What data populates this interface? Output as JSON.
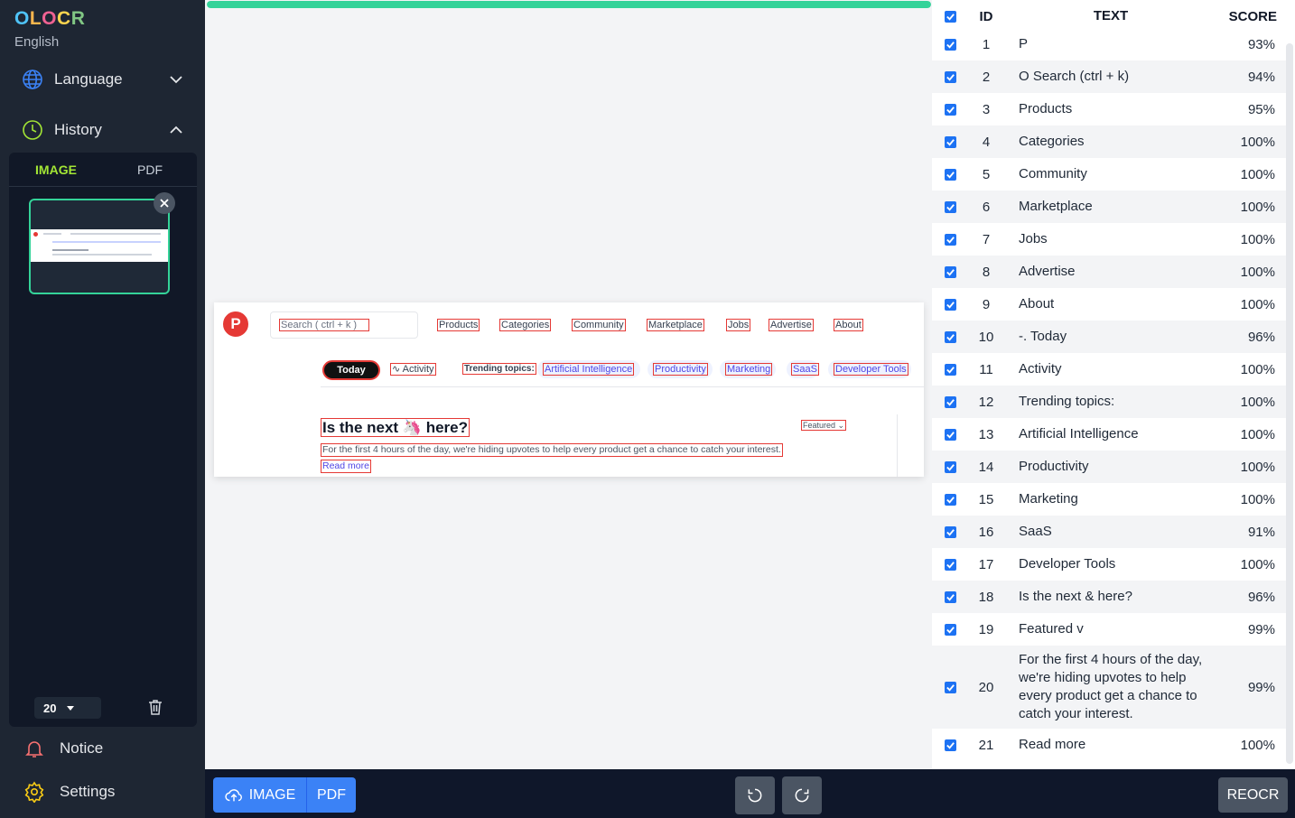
{
  "app": {
    "brand": "OLOCR",
    "subtitle": "English"
  },
  "sidebar": {
    "language_label": "Language",
    "history_label": "History",
    "history_tabs": [
      {
        "label": "IMAGE",
        "active": true
      },
      {
        "label": "PDF",
        "active": false
      }
    ],
    "page_size": "20",
    "notice_label": "Notice",
    "settings_label": "Settings",
    "icons": {
      "language": "globe-icon",
      "history": "clock-icon",
      "notice": "bell-icon",
      "settings": "gear-icon",
      "delete": "trash-icon"
    }
  },
  "progress": {
    "percent": 100,
    "color": "#34d399"
  },
  "preview": {
    "logo": "P",
    "search": "Search ( ctrl + k )",
    "nav": [
      "Products",
      "Categories",
      "Community",
      "Marketplace",
      "Jobs",
      "Advertise",
      "About"
    ],
    "today": "Today",
    "activity": "Activity",
    "trending": "Trending topics:",
    "topics": [
      "Artificial Intelligence",
      "Productivity",
      "Marketing",
      "SaaS",
      "Developer Tools"
    ],
    "headline": "Is the next 🦄 here?",
    "featured": "Featured ⌄",
    "subline": "For the first 4 hours of the day, we're hiding upvotes to help every product get a chance to catch your interest.",
    "read_more": "Read more"
  },
  "table": {
    "headers": {
      "id": "ID",
      "text": "TEXT",
      "score": "SCORE"
    },
    "rows": [
      {
        "id": "1",
        "text": "P",
        "score": "93%"
      },
      {
        "id": "2",
        "text": "O Search (ctrl + k)",
        "score": "94%"
      },
      {
        "id": "3",
        "text": "Products",
        "score": "95%"
      },
      {
        "id": "4",
        "text": "Categories",
        "score": "100%"
      },
      {
        "id": "5",
        "text": "Community",
        "score": "100%"
      },
      {
        "id": "6",
        "text": "Marketplace",
        "score": "100%"
      },
      {
        "id": "7",
        "text": "Jobs",
        "score": "100%"
      },
      {
        "id": "8",
        "text": "Advertise",
        "score": "100%"
      },
      {
        "id": "9",
        "text": "About",
        "score": "100%"
      },
      {
        "id": "10",
        "text": "-. Today",
        "score": "96%"
      },
      {
        "id": "11",
        "text": " Activity",
        "score": "100%"
      },
      {
        "id": "12",
        "text": "Trending topics:",
        "score": "100%"
      },
      {
        "id": "13",
        "text": "Artificial Intelligence",
        "score": "100%"
      },
      {
        "id": "14",
        "text": "Productivity",
        "score": "100%"
      },
      {
        "id": "15",
        "text": "Marketing",
        "score": "100%"
      },
      {
        "id": "16",
        "text": "SaaS",
        "score": "91%"
      },
      {
        "id": "17",
        "text": "Developer Tools",
        "score": "100%"
      },
      {
        "id": "18",
        "text": "Is the next & here?",
        "score": "96%"
      },
      {
        "id": "19",
        "text": "Featured v",
        "score": "99%"
      },
      {
        "id": "20",
        "text": "For the first 4 hours of the day, we're hiding upvotes to help every product get a chance to catch your interest.",
        "score": "99%"
      },
      {
        "id": "21",
        "text": "Read more",
        "score": "100%"
      }
    ]
  },
  "bottombar": {
    "image_button": "IMAGE",
    "pdf_button": "PDF",
    "reocr_button": "REOCR",
    "icons": {
      "upload": "cloud-upload-icon",
      "rotate_left": "rotate-left-icon",
      "rotate_right": "rotate-right-icon"
    }
  }
}
